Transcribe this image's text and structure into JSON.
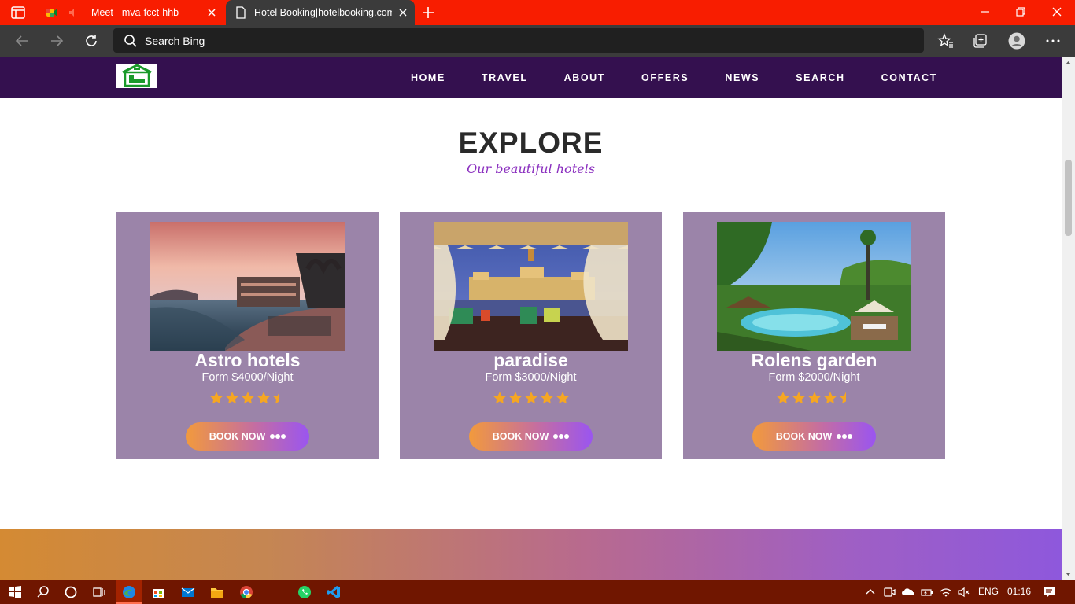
{
  "browser": {
    "tabs": [
      {
        "title": "Meet - mva-fcct-hhb"
      },
      {
        "title": "Hotel Booking|hotelbooking.com"
      }
    ],
    "address_placeholder": "Search Bing"
  },
  "site": {
    "nav": [
      "HOME",
      "TRAVEL",
      "ABOUT",
      "OFFERS",
      "NEWS",
      "SEARCH",
      "CONTACT"
    ],
    "explore_title": "EXPLORE",
    "explore_subtitle": "Our beautiful hotels",
    "cards": [
      {
        "name": "Astro hotels",
        "price": "Form $4000/Night",
        "rating": 4.5,
        "book_label": "BOOK NOW"
      },
      {
        "name": "paradise",
        "price": "Form $3000/Night",
        "rating": 5,
        "book_label": "BOOK NOW"
      },
      {
        "name": "Rolens garden",
        "price": "Form $2000/Night",
        "rating": 4.5,
        "book_label": "BOOK NOW"
      }
    ]
  },
  "taskbar": {
    "language": "ENG",
    "time": "01:16"
  },
  "colors": {
    "tab_bar": "#f81d00",
    "site_header": "#34104f",
    "card_bg": "#9b84a9",
    "star": "#f5a623",
    "subtitle": "#8a2ebf"
  }
}
